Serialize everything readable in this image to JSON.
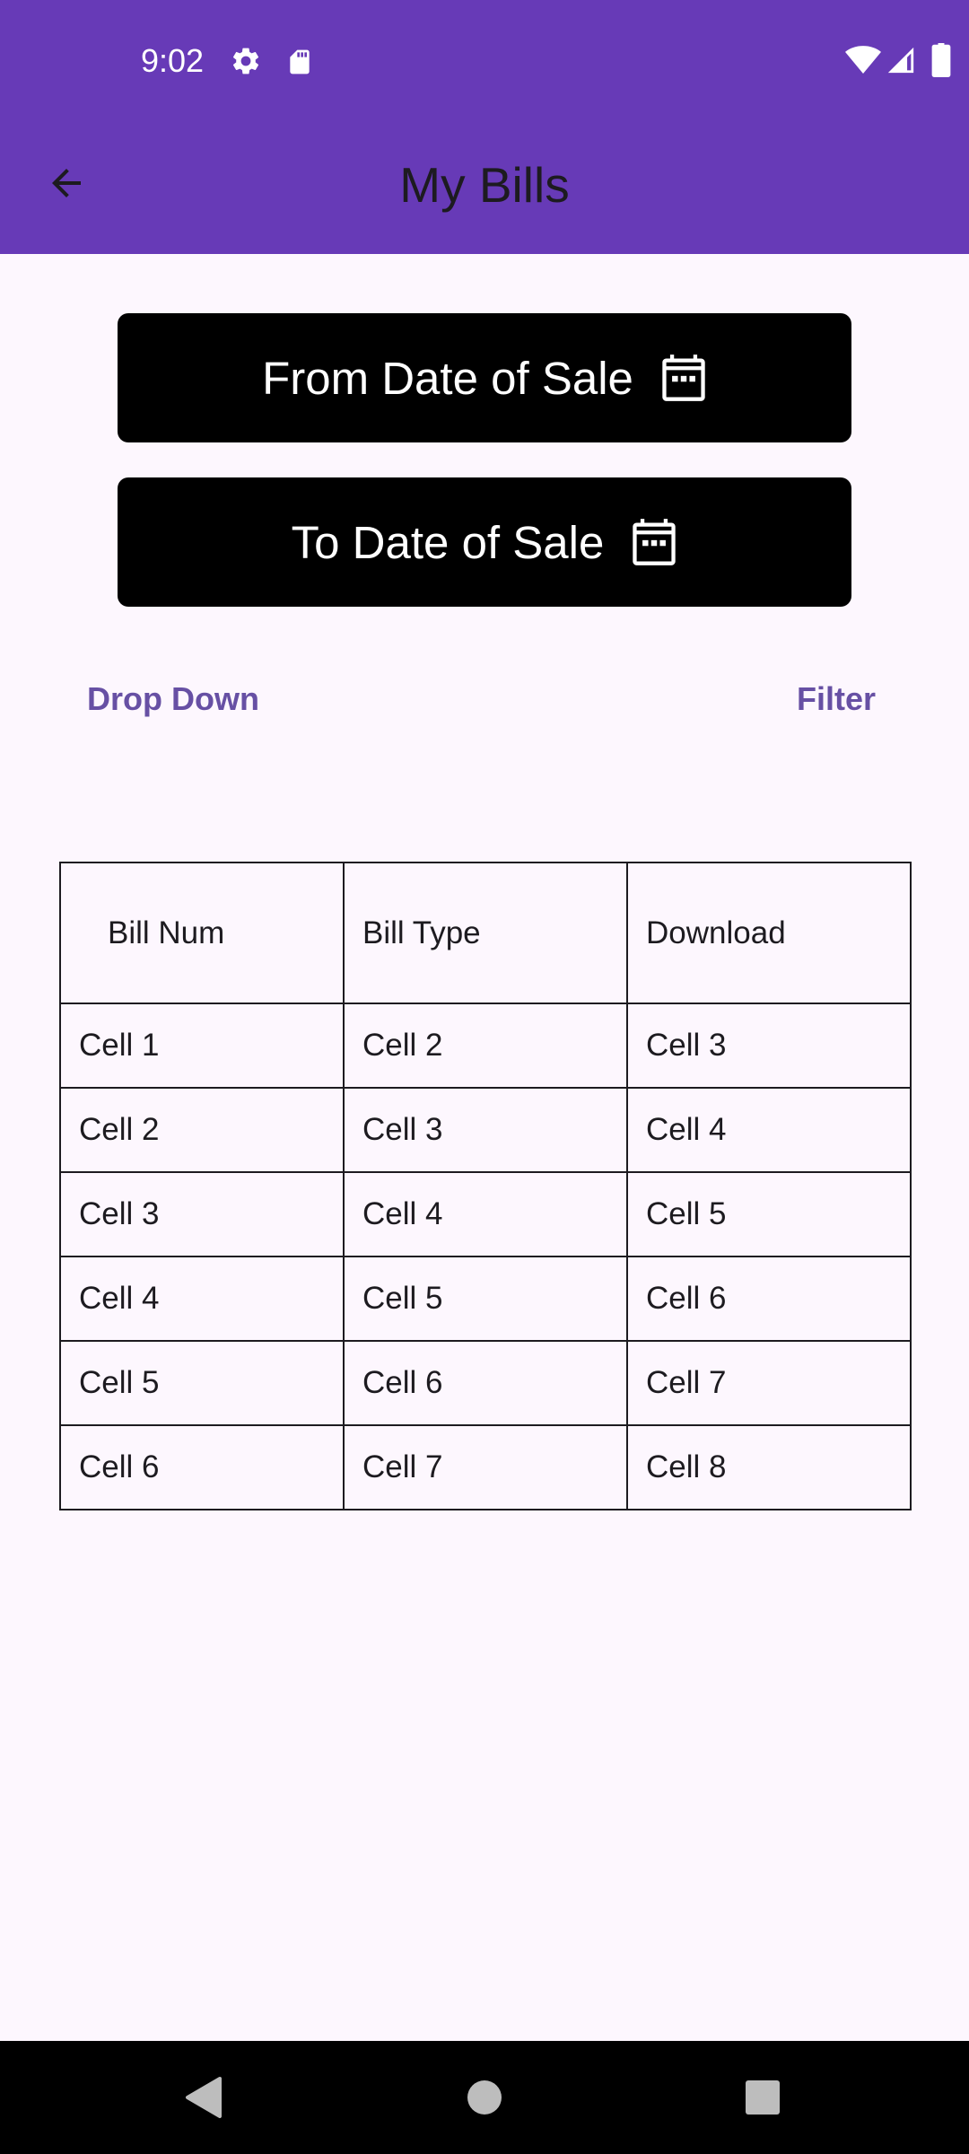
{
  "status_bar": {
    "time": "9:02",
    "icons": [
      "gear-icon",
      "sd-card-icon",
      "wifi-icon",
      "signal-icon",
      "battery-icon"
    ]
  },
  "app_bar": {
    "title": "My Bills",
    "back_icon": "arrow-back-icon"
  },
  "filters": {
    "from_date_label": "From Date of Sale",
    "to_date_label": "To Date of Sale",
    "dropdown_label": "Drop Down",
    "filter_label": "Filter"
  },
  "table": {
    "headers": [
      "Bill Num",
      "Bill Type",
      "Download"
    ],
    "rows": [
      [
        "Cell 1",
        "Cell 2",
        "Cell 3"
      ],
      [
        "Cell 2",
        "Cell 3",
        "Cell 4"
      ],
      [
        "Cell 3",
        "Cell 4",
        "Cell 5"
      ],
      [
        "Cell 4",
        "Cell 5",
        "Cell 6"
      ],
      [
        "Cell 5",
        "Cell 6",
        "Cell 7"
      ],
      [
        "Cell 6",
        "Cell 7",
        "Cell 8"
      ]
    ]
  },
  "colors": {
    "header_bg": "#673AB7",
    "page_bg": "#FDF7FE",
    "button_bg": "#000000",
    "text_button": "#6750A4"
  }
}
